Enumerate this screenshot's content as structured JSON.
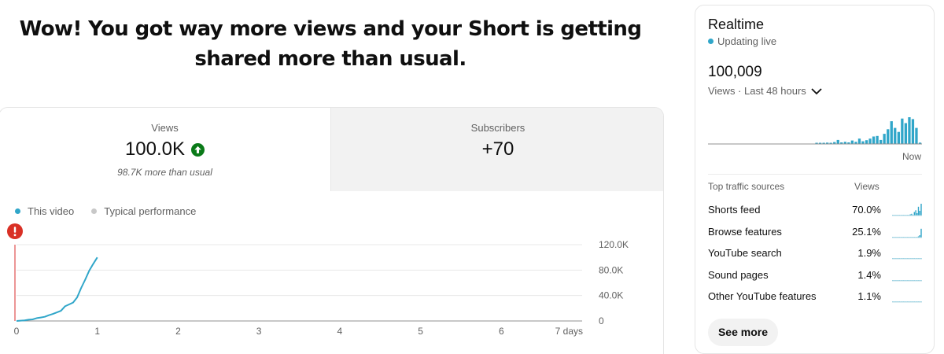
{
  "headline": "Wow! You got way more views and your Short is getting shared more than usual.",
  "tabs": {
    "views": {
      "label": "Views",
      "value": "100.0K",
      "note": "98.7K more than usual",
      "icon": "arrow-up-circle-icon"
    },
    "subscribers": {
      "label": "Subscribers",
      "value": "+70"
    }
  },
  "legend": {
    "this_video": "This video",
    "typical": "Typical performance"
  },
  "colors": {
    "series": "#30a6c9",
    "typical": "#c8c8c8",
    "alert": "#d93025",
    "up": "#0a7a18",
    "live_dot": "#30a6c9"
  },
  "chart_data": {
    "type": "line",
    "x_ticks": [
      "0",
      "1",
      "2",
      "3",
      "4",
      "5",
      "6",
      "7 days"
    ],
    "y_ticks": [
      "120.0K",
      "80.0K",
      "40.0K",
      "0"
    ],
    "ylim": [
      0,
      120000
    ],
    "xlim": [
      0,
      7
    ],
    "series": [
      {
        "name": "This video",
        "x": [
          0,
          0.05,
          0.1,
          0.15,
          0.2,
          0.25,
          0.3,
          0.35,
          0.4,
          0.45,
          0.5,
          0.55,
          0.6,
          0.65,
          0.7,
          0.75,
          0.8,
          0.85,
          0.9,
          0.95,
          1.0
        ],
        "y": [
          0,
          500,
          1000,
          2000,
          2500,
          4500,
          5500,
          6500,
          9000,
          11000,
          13500,
          16000,
          23000,
          26000,
          29000,
          37000,
          52000,
          65000,
          79000,
          90000,
          100000
        ]
      }
    ]
  },
  "realtime": {
    "title": "Realtime",
    "live": "Updating live",
    "count": "100,009",
    "period": "Views · Last 48 hours",
    "now_label": "Now",
    "bars": [
      0,
      0,
      0,
      0,
      0,
      0,
      0,
      0,
      0,
      0,
      0,
      0,
      0,
      0,
      0,
      0,
      0,
      0,
      0,
      0,
      0,
      0,
      0,
      0,
      0,
      0,
      0,
      0,
      0,
      0,
      0.03,
      0.02,
      0.04,
      0.05,
      0.03,
      0.07,
      0.15,
      0.06,
      0.08,
      0.06,
      0.13,
      0.08,
      0.2,
      0.1,
      0.14,
      0.2,
      0.28,
      0.3,
      0.15,
      0.38,
      0.55,
      0.85,
      0.6,
      0.45,
      0.95,
      0.78,
      1.0,
      0.93,
      0.6,
      0.05
    ]
  },
  "traffic_sources": {
    "header_label": "Top traffic sources",
    "header_views": "Views",
    "rows": [
      {
        "name": "Shorts feed",
        "pct": "70.0%",
        "spark": [
          0,
          0,
          0,
          0,
          0,
          0,
          0,
          0,
          0,
          0,
          0,
          0,
          0.05,
          0.1,
          0.15,
          0.05,
          0.3,
          0.45,
          0.2,
          0.75,
          0.4,
          1.0
        ]
      },
      {
        "name": "Browse features",
        "pct": "25.1%",
        "spark": [
          0,
          0,
          0,
          0,
          0,
          0,
          0,
          0,
          0,
          0,
          0,
          0,
          0,
          0,
          0,
          0,
          0,
          0,
          0,
          0.1,
          0.2,
          0.75
        ]
      },
      {
        "name": "YouTube search",
        "pct": "1.9%",
        "spark": [
          0.04,
          0.04,
          0.04,
          0.04,
          0.04,
          0.04,
          0.04,
          0.04,
          0.04,
          0.04,
          0.04,
          0.04,
          0.04,
          0.04,
          0.04,
          0.04,
          0.04,
          0.04,
          0.04,
          0.04,
          0.04,
          0.04
        ]
      },
      {
        "name": "Sound pages",
        "pct": "1.4%",
        "spark": [
          0.04,
          0.04,
          0.04,
          0.04,
          0.04,
          0.04,
          0.04,
          0.04,
          0.04,
          0.04,
          0.04,
          0.04,
          0.04,
          0.04,
          0.04,
          0.04,
          0.04,
          0.04,
          0.04,
          0.04,
          0.04,
          0.04
        ]
      },
      {
        "name": "Other YouTube features",
        "pct": "1.1%",
        "spark": [
          0.04,
          0.04,
          0.04,
          0.04,
          0.04,
          0.04,
          0.04,
          0.04,
          0.04,
          0.04,
          0.04,
          0.04,
          0.04,
          0.04,
          0.04,
          0.04,
          0.04,
          0.04,
          0.04,
          0.04,
          0.04,
          0.04
        ]
      }
    ]
  },
  "see_more": "See more"
}
